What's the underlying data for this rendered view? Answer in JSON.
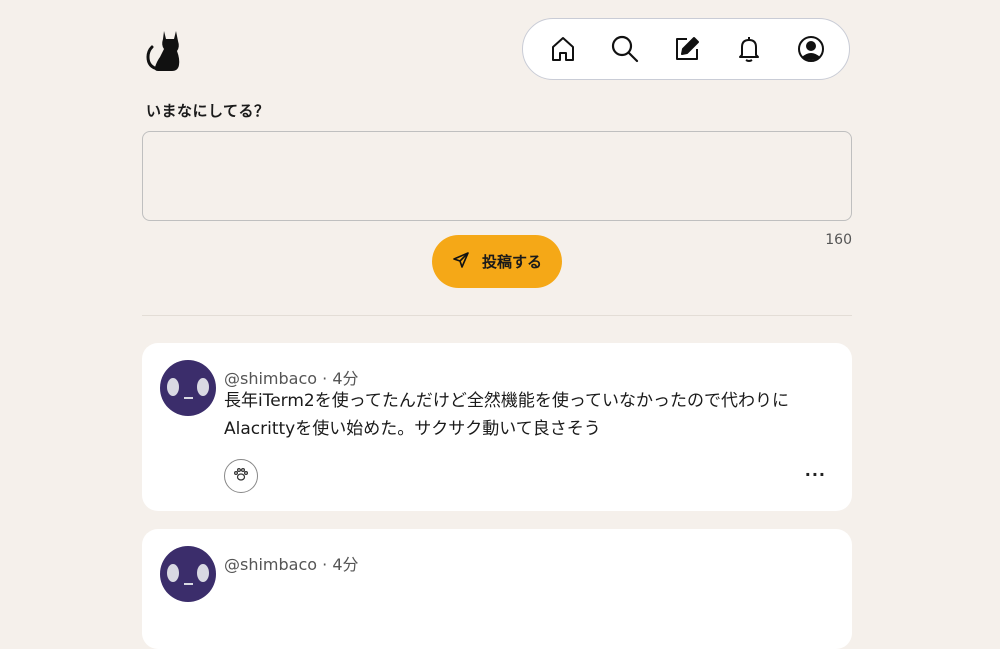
{
  "header": {
    "logo_icon": "cat-icon",
    "nav": [
      {
        "name": "home",
        "icon": "home-icon"
      },
      {
        "name": "search",
        "icon": "search-icon"
      },
      {
        "name": "compose",
        "icon": "edit-icon"
      },
      {
        "name": "notifications",
        "icon": "bell-icon"
      },
      {
        "name": "profile",
        "icon": "user-icon"
      }
    ]
  },
  "compose": {
    "prompt": "いまなにしてる？",
    "value": "",
    "remaining": "160",
    "submit_label": "投稿する",
    "accent": "#f5a817"
  },
  "posts": [
    {
      "handle": "@shimbaco",
      "separator": "·",
      "time": "4分",
      "text_line1": "長年iTerm2を使ってたんだけど全然機能を使っていなかったので代わりに",
      "text_line2": "Alacrittyを使い始めた。サクサク動いて良さそう",
      "more": "···"
    },
    {
      "handle": "@shimbaco",
      "separator": "·",
      "time": "4分"
    }
  ],
  "colors": {
    "background": "#f5f0eb",
    "avatar": "#3b2d6b",
    "card": "#ffffff"
  }
}
